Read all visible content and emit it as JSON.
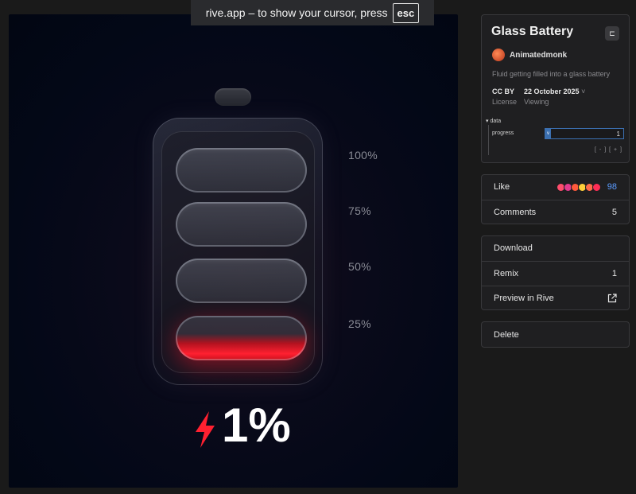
{
  "toast": {
    "text": "rive.app – to show your cursor, press",
    "key": "esc"
  },
  "preview": {
    "levels": [
      "100%",
      "75%",
      "50%",
      "25%"
    ],
    "percent": "1%",
    "fill_level": 0.01,
    "accent": "#ff2030"
  },
  "info": {
    "title": "Glass Battery",
    "author": "Animatedmonk",
    "description": "Fluid getting filled into a glass battery",
    "license_value": "CC BY",
    "license_label": "License",
    "date_value": "22 October 2025",
    "date_label": "Viewing",
    "data_section": "data",
    "progress_label": "progress",
    "progress_value": "1",
    "progress_tag": "v",
    "stepper_minus": "[ - ]",
    "stepper_plus": "[ + ]"
  },
  "social": {
    "like_label": "Like",
    "like_count": "98",
    "reaction_colors": [
      "#ff4d6d",
      "#e33b8f",
      "#ff5a3c",
      "#ffcf3a",
      "#ff6b4a",
      "#ff2d55"
    ],
    "comments_label": "Comments",
    "comments_count": "5"
  },
  "actions": {
    "download_label": "Download",
    "remix_label": "Remix",
    "remix_count": "1",
    "preview_label": "Preview in Rive"
  },
  "danger": {
    "delete_label": "Delete"
  }
}
